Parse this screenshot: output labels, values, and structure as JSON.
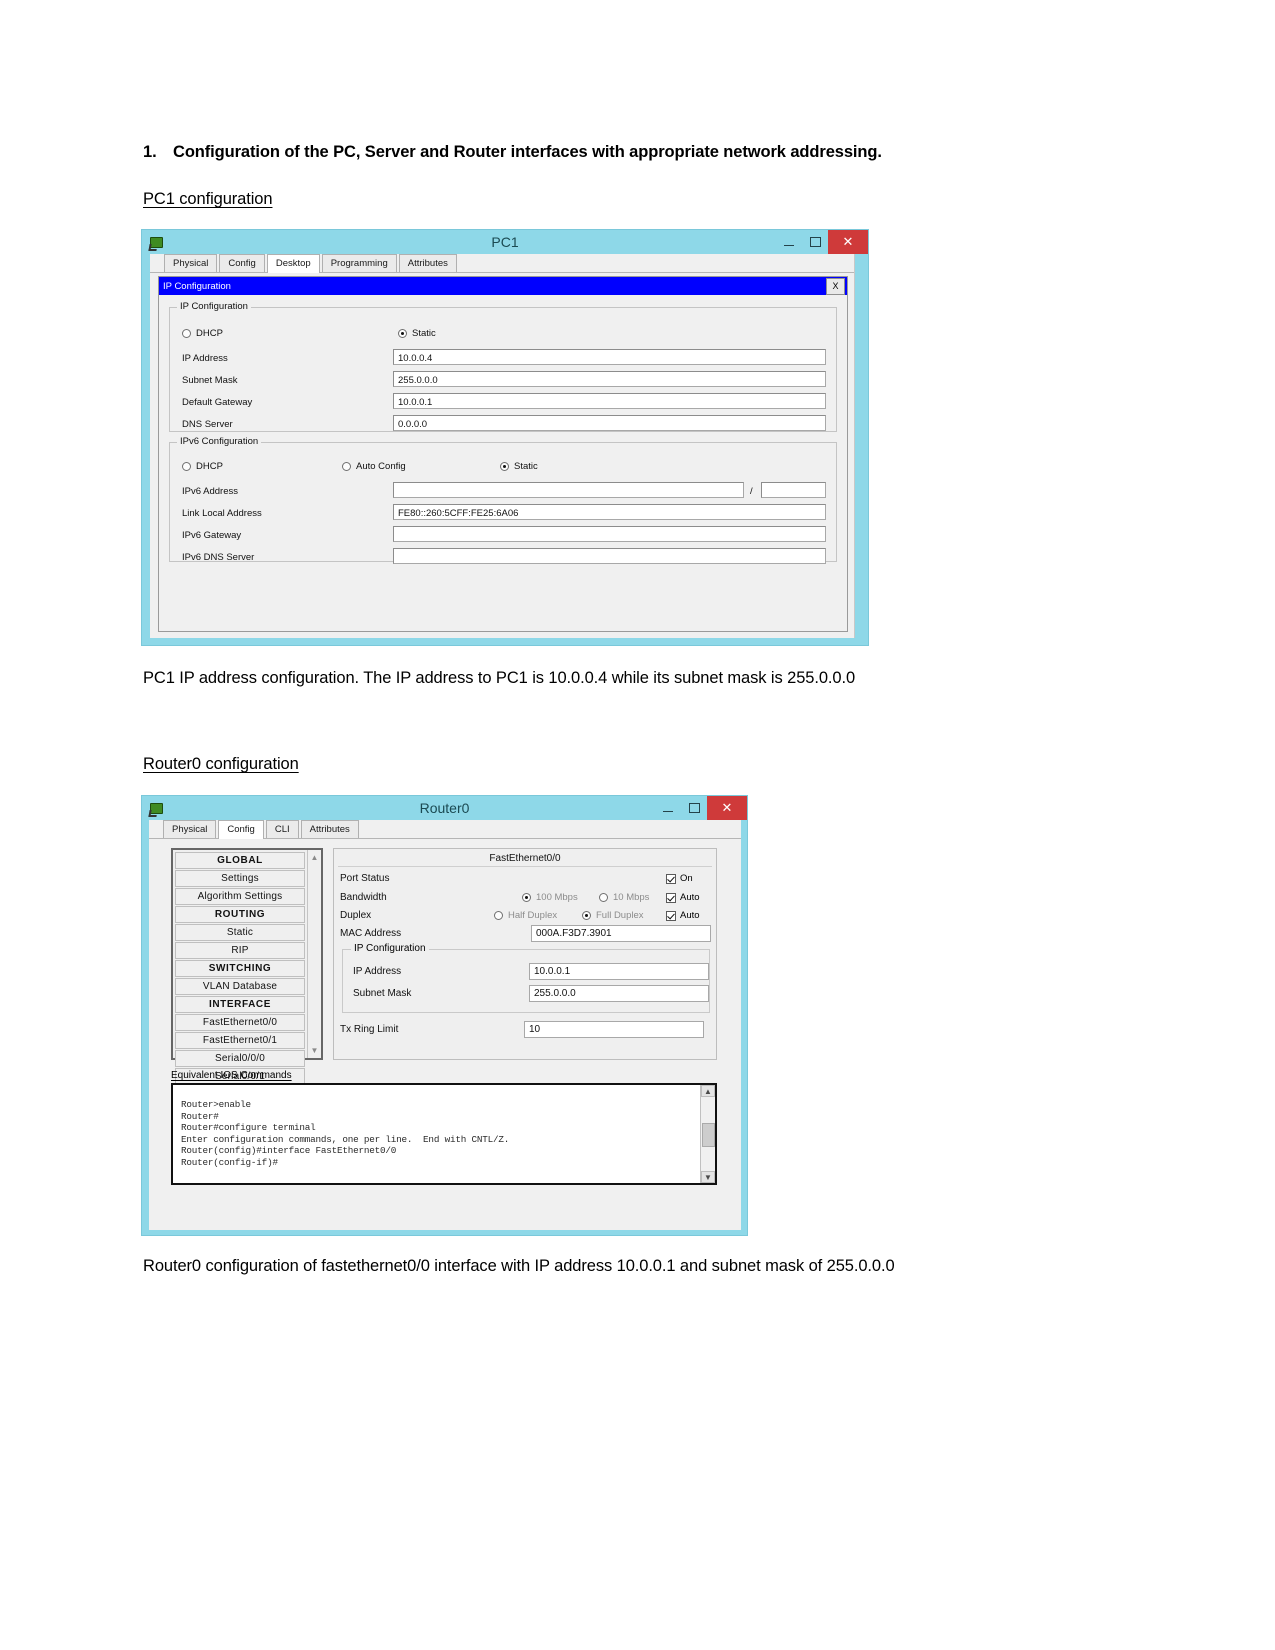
{
  "document": {
    "heading_number": "1.",
    "heading_text": "Configuration of the PC, Server and Router interfaces with appropriate network addressing.",
    "pc1_section_label": "PC1 configuration",
    "pc1_caption": "PC1 IP address configuration. The IP address to PC1 is 10.0.0.4 while its subnet mask is 255.0.0.0",
    "router0_section_label": "Router0 configuration",
    "router0_caption": "Router0 configuration of fastethernet0/0 interface with IP address 10.0.0.1 and subnet mask of 255.0.0.0"
  },
  "pc1_window": {
    "title": "PC1",
    "minimize_label": "–",
    "maximize_label": "▭",
    "close_label": "✕",
    "tabs": [
      {
        "label": "Physical",
        "active": false
      },
      {
        "label": "Config",
        "active": false
      },
      {
        "label": "Desktop",
        "active": true
      },
      {
        "label": "Programming",
        "active": false
      },
      {
        "label": "Attributes",
        "active": false
      }
    ],
    "dialog": {
      "title": "IP Configuration",
      "close_label": "X",
      "ipv4": {
        "legend": "IP Configuration",
        "dhcp_label": "DHCP",
        "static_label": "Static",
        "selected": "Static",
        "fields": [
          {
            "label": "IP Address",
            "value": "10.0.0.4"
          },
          {
            "label": "Subnet Mask",
            "value": "255.0.0.0"
          },
          {
            "label": "Default Gateway",
            "value": "10.0.0.1"
          },
          {
            "label": "DNS Server",
            "value": "0.0.0.0"
          }
        ]
      },
      "ipv6": {
        "legend": "IPv6 Configuration",
        "dhcp_label": "DHCP",
        "auto_config_label": "Auto Config",
        "static_label": "Static",
        "selected": "Static",
        "prefix_separator": "/",
        "fields": [
          {
            "label": "IPv6 Address",
            "value": ""
          },
          {
            "label": "Link Local Address",
            "value": "FE80::260:5CFF:FE25:6A06"
          },
          {
            "label": "IPv6 Gateway",
            "value": ""
          },
          {
            "label": "IPv6 DNS Server",
            "value": ""
          }
        ],
        "prefix_value": ""
      }
    }
  },
  "router0_window": {
    "title": "Router0",
    "minimize_label": "–",
    "maximize_label": "▭",
    "close_label": "✕",
    "tabs": [
      {
        "label": "Physical",
        "active": false
      },
      {
        "label": "Config",
        "active": true
      },
      {
        "label": "CLI",
        "active": false
      },
      {
        "label": "Attributes",
        "active": false
      }
    ],
    "sidebar": {
      "items": [
        {
          "label": "GLOBAL",
          "header": true
        },
        {
          "label": "Settings",
          "header": false
        },
        {
          "label": "Algorithm Settings",
          "header": false
        },
        {
          "label": "ROUTING",
          "header": true
        },
        {
          "label": "Static",
          "header": false
        },
        {
          "label": "RIP",
          "header": false
        },
        {
          "label": "SWITCHING",
          "header": true
        },
        {
          "label": "VLAN Database",
          "header": false
        },
        {
          "label": "INTERFACE",
          "header": true
        },
        {
          "label": "FastEthernet0/0",
          "header": false
        },
        {
          "label": "FastEthernet0/1",
          "header": false
        },
        {
          "label": "Serial0/0/0",
          "header": false
        },
        {
          "label": "Serial0/0/1",
          "header": false
        }
      ],
      "scroll_up": "▲",
      "scroll_down": "▼"
    },
    "interface_panel": {
      "title": "FastEthernet0/0",
      "port_status_label": "Port Status",
      "port_status_on_label": "On",
      "port_status_on": true,
      "bandwidth_label": "Bandwidth",
      "bandwidth_100_label": "100 Mbps",
      "bandwidth_10_label": "10 Mbps",
      "bandwidth_selected": "100 Mbps",
      "bandwidth_auto_label": "Auto",
      "bandwidth_auto": true,
      "duplex_label": "Duplex",
      "duplex_half_label": "Half Duplex",
      "duplex_full_label": "Full Duplex",
      "duplex_selected": "Full Duplex",
      "duplex_auto_label": "Auto",
      "duplex_auto": true,
      "mac_label": "MAC Address",
      "mac_value": "000A.F3D7.3901",
      "ip_group_legend": "IP Configuration",
      "ip_address_label": "IP Address",
      "ip_address_value": "10.0.0.1",
      "subnet_mask_label": "Subnet Mask",
      "subnet_mask_value": "255.0.0.0",
      "tx_ring_label": "Tx Ring Limit",
      "tx_ring_value": "10"
    },
    "ios": {
      "label": "Equivalent IOS Commands",
      "text": "Router>enable\nRouter#\nRouter#configure terminal\nEnter configuration commands, one per line.  End with CNTL/Z.\nRouter(config)#interface FastEthernet0/0\nRouter(config-if)#",
      "scroll_up": "▲",
      "scroll_down": "▼"
    }
  },
  "colors": {
    "titlebar": "#8ed8e8",
    "close_button": "#cf3a3a",
    "dialog_titlebar": "#0000ff",
    "panel": "#f0f0f0"
  }
}
